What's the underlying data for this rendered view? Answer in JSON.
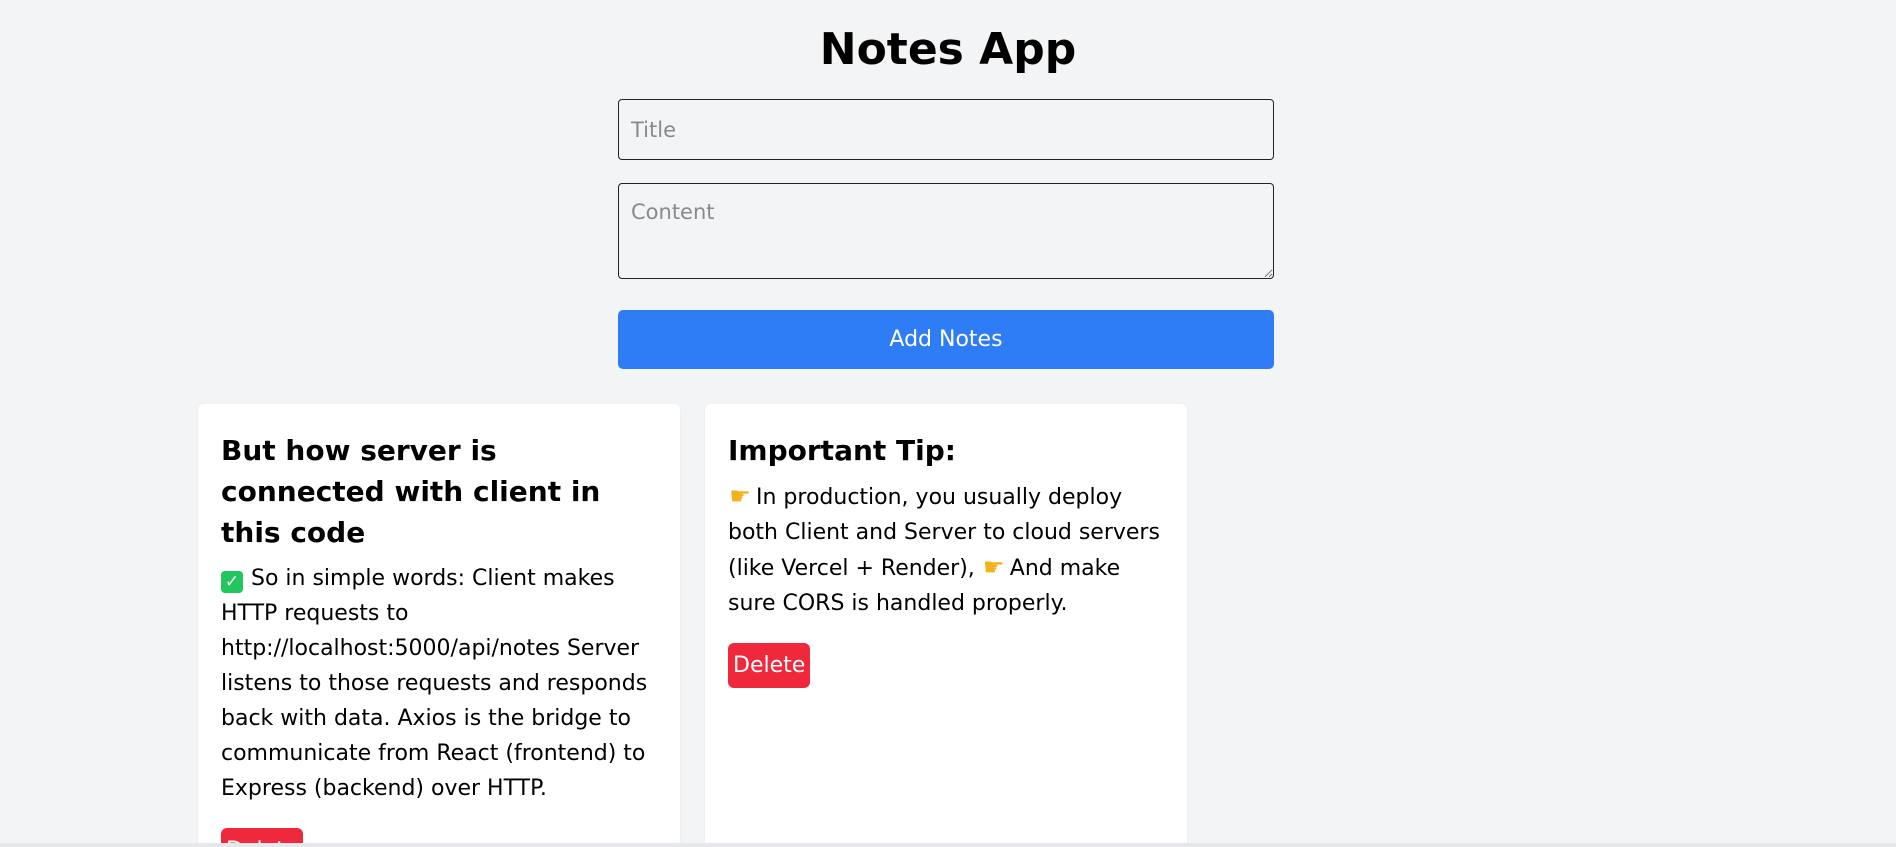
{
  "app": {
    "title": "Notes App"
  },
  "form": {
    "title_placeholder": "Title",
    "content_placeholder": "Content",
    "title_value": "",
    "content_value": "",
    "add_button_label": "Add Notes"
  },
  "notes": [
    {
      "title": "But how server is connected with client in this code",
      "content_icon": "check-mark-icon",
      "content": "So in simple words: Client makes HTTP requests to http://localhost:5000/api/notes Server listens to those requests and responds back with data. Axios is the bridge to communicate from React (frontend) to Express (backend) over HTTP.",
      "delete_label": "Delete"
    },
    {
      "title": "Important Tip:",
      "content_part_1": "In production, you usually deploy both Client and Server to cloud servers (like Vercel + Render),",
      "content_part_2": "And make sure CORS is handled properly.",
      "delete_label": "Delete"
    }
  ],
  "colors": {
    "background": "#f3f4f6",
    "primary_button": "#2e7df7",
    "danger_button": "#f0283c",
    "card_background": "#ffffff"
  }
}
